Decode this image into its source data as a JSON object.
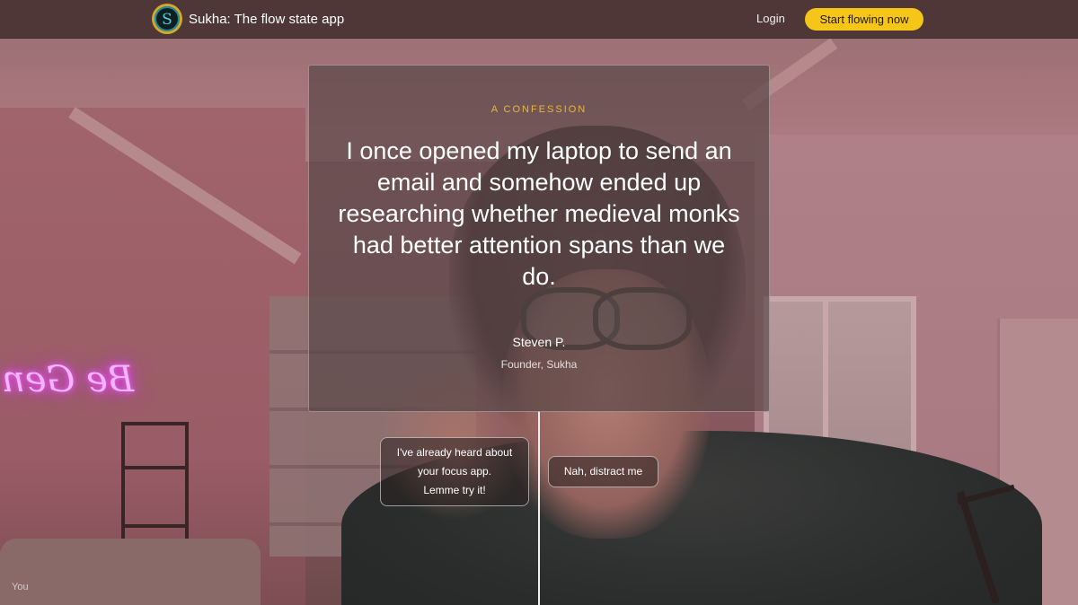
{
  "header": {
    "brand_name": "Sukha: The flow state app",
    "logo_letter": "S",
    "login_label": "Login",
    "cta_label": "Start flowing now"
  },
  "card": {
    "eyebrow": "A CONFESSION",
    "quote": "I once opened my laptop to send an email and somehow ended up researching whether medieval monks had better attention spans than we do.",
    "author": "Steven P.",
    "role": "Founder, Sukha"
  },
  "choices": {
    "try_label": "I've already heard about\nyour focus app.\nLemme try it!",
    "distract_label": "Nah, distract me"
  },
  "video": {
    "self_label": "You",
    "neon_sign_text": "Be Gen"
  },
  "colors": {
    "accent_yellow": "#f5c518",
    "eyebrow_gold": "#e9b63a",
    "nav_background": "#4a3434",
    "logo_teal": "#1e8ea0"
  }
}
